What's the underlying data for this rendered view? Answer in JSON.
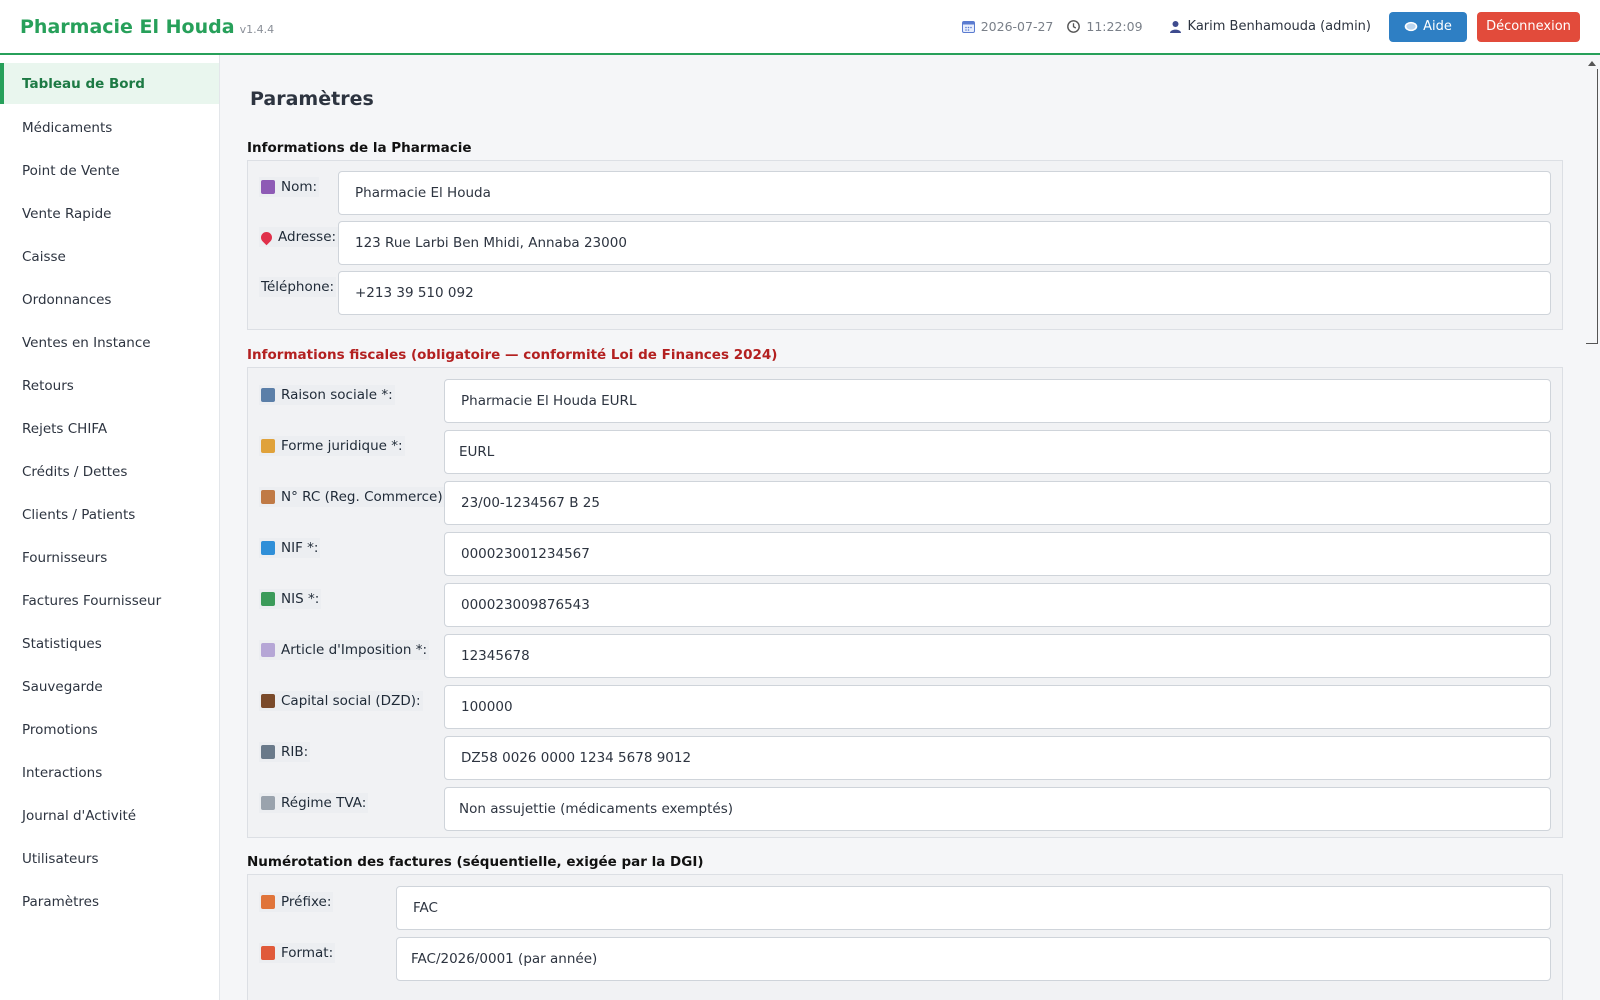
{
  "header": {
    "brand": "Pharmacie El Houda",
    "version": "v1.4.4",
    "date": "2026-07-27",
    "time": "11:22:09",
    "user": "Karim Benhamouda (admin)",
    "help_label": "Aide",
    "logout_label": "Déconnexion"
  },
  "sidebar": {
    "items": [
      {
        "label": "Tableau de Bord",
        "active": true
      },
      {
        "label": "Médicaments"
      },
      {
        "label": "Point de Vente"
      },
      {
        "label": "Vente Rapide"
      },
      {
        "label": "Caisse"
      },
      {
        "label": "Ordonnances"
      },
      {
        "label": "Ventes en Instance"
      },
      {
        "label": "Retours"
      },
      {
        "label": "Rejets CHIFA"
      },
      {
        "label": "Crédits / Dettes"
      },
      {
        "label": "Clients / Patients"
      },
      {
        "label": "Fournisseurs"
      },
      {
        "label": "Factures Fournisseur"
      },
      {
        "label": "Statistiques"
      },
      {
        "label": "Sauvegarde"
      },
      {
        "label": "Promotions"
      },
      {
        "label": "Interactions"
      },
      {
        "label": "Journal d'Activité"
      },
      {
        "label": "Utilisateurs"
      },
      {
        "label": "Paramètres"
      }
    ]
  },
  "main": {
    "title": "Paramètres",
    "pharmacy": {
      "title": "Informations de la Pharmacie",
      "fields": [
        {
          "icon": "building-icon",
          "icon_color": "#8e5bb5",
          "label": "Nom:",
          "value": "Pharmacie El Houda"
        },
        {
          "icon": "pin-icon",
          "icon_color": "#e0304a",
          "label": "Adresse:",
          "value": "123 Rue Larbi Ben Mhidi, Annaba 23000"
        },
        {
          "icon": "",
          "icon_color": "",
          "label": "Téléphone:",
          "value": "+213 39 510 092"
        }
      ]
    },
    "fiscal": {
      "title": "Informations fiscales (obligatoire — conformité Loi de Finances 2024)",
      "fields": [
        {
          "icon": "office-icon",
          "icon_color": "#5b7fa8",
          "label": "Raison sociale *:",
          "value": "Pharmacie El Houda EURL"
        },
        {
          "icon": "scale-icon",
          "icon_color": "#e0a23a",
          "label": "Forme juridique *:",
          "value": "EURL"
        },
        {
          "icon": "clipboard-icon",
          "icon_color": "#c07a45",
          "label": "N° RC (Reg. Commerce) *:",
          "value": "23/00-1234567 B 25"
        },
        {
          "icon": "numbers-icon",
          "icon_color": "#2f8fd8",
          "label": "NIF *:",
          "value": "000023001234567"
        },
        {
          "icon": "bar-chart-icon",
          "icon_color": "#3b9b5a",
          "label": "NIS *:",
          "value": "000023009876543"
        },
        {
          "icon": "memo-icon",
          "icon_color": "#b5a6d6",
          "label": "Article d'Imposition *:",
          "value": "12345678"
        },
        {
          "icon": "briefcase-icon",
          "icon_color": "#7a4a2a",
          "label": "Capital social (DZD):",
          "value": "100000"
        },
        {
          "icon": "bank-icon",
          "icon_color": "#6a7a8a",
          "label": "RIB:",
          "value": "DZ58 0026 0000 1234 5678 9012"
        },
        {
          "icon": "ruler-icon",
          "icon_color": "#9aa3ad",
          "label": "Régime TVA:",
          "value": "Non assujettie (médicaments exemptés)"
        }
      ]
    },
    "numbering": {
      "title": "Numérotation des factures (séquentielle, exigée par la DGI)",
      "fields": [
        {
          "icon": "pencil-memo-icon",
          "icon_color": "#e0743a",
          "label": "Préfixe:",
          "value": "FAC"
        },
        {
          "icon": "calendar-grid-icon",
          "icon_color": "#e05a3a",
          "label": "Format:",
          "value": "FAC/2026/0001 (par année)"
        }
      ]
    }
  }
}
